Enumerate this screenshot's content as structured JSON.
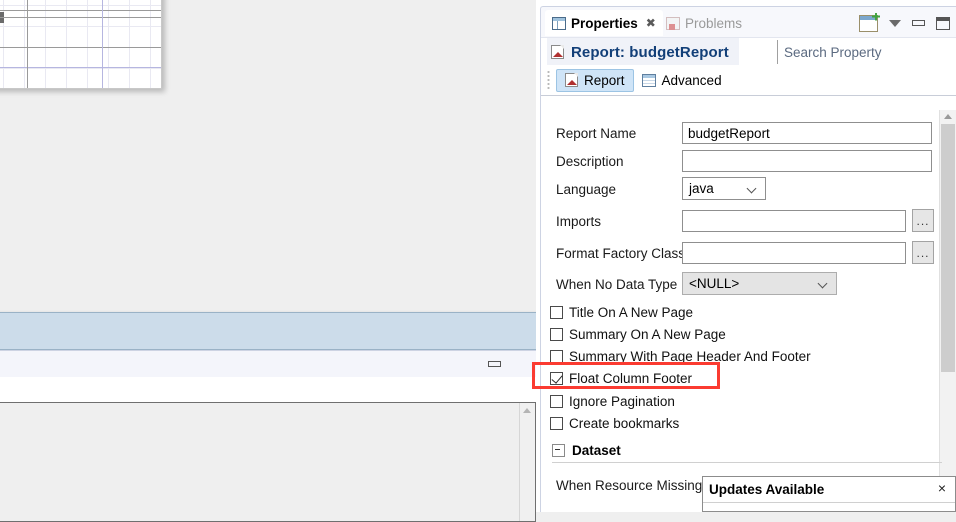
{
  "view": {
    "tabs": [
      {
        "label": "Properties",
        "icon": "table-icon",
        "active": true,
        "closable": true
      },
      {
        "label": "Problems",
        "icon": "problems-icon",
        "active": false,
        "closable": false
      }
    ],
    "toolbar": [
      {
        "name": "new-properties-view-icon",
        "tooltip": "New Properties View"
      },
      {
        "name": "view-menu-icon",
        "tooltip": "View Menu"
      },
      {
        "name": "minimize-icon",
        "tooltip": "Minimize"
      },
      {
        "name": "maximize-icon",
        "tooltip": "Maximize"
      }
    ]
  },
  "header": {
    "icon": "report-icon",
    "title": "Report: budgetReport",
    "search": {
      "placeholder": "Search Property",
      "value": ""
    }
  },
  "subtabs": [
    {
      "label": "Report",
      "icon": "report-icon",
      "selected": true
    },
    {
      "label": "Advanced",
      "icon": "advanced-icon",
      "selected": false
    }
  ],
  "form": {
    "fields": [
      {
        "label": "Report Name",
        "type": "text",
        "value": "budgetReport"
      },
      {
        "label": "Description",
        "type": "text",
        "value": ""
      },
      {
        "label": "Language",
        "type": "combo",
        "value": "java"
      },
      {
        "label": "Imports",
        "type": "text-browse",
        "value": "",
        "browse_label": "..."
      },
      {
        "label": "Format Factory Class",
        "type": "text-browse",
        "value": "",
        "browse_label": "..."
      },
      {
        "label": "When No Data Type",
        "type": "combo-disabled",
        "value": "<NULL>"
      }
    ],
    "checkboxes": [
      {
        "label": "Title On A New Page",
        "checked": false
      },
      {
        "label": "Summary On A New Page",
        "checked": false
      },
      {
        "label": "Summary With Page Header And Footer",
        "checked": false
      },
      {
        "label": "Float Column Footer",
        "checked": true,
        "highlighted": true
      },
      {
        "label": "Ignore Pagination",
        "checked": false
      },
      {
        "label": "Create bookmarks",
        "checked": false
      }
    ],
    "sections": [
      {
        "title": "Dataset",
        "expanded": true
      }
    ],
    "dataset": {
      "first_row_label": "When Resource Missing T"
    }
  },
  "updates_popup": {
    "title": "Updates Available",
    "close_label": "×"
  },
  "annotation": {
    "color": "#fb3b31",
    "target": "Float Column Footer"
  },
  "editor": {
    "band_selected": true,
    "panel_tools": [
      {
        "name": "restore-icon"
      },
      {
        "name": "maximize-icon"
      }
    ]
  },
  "colors": {
    "accent": "#123f78",
    "selection": "#cfe4f7",
    "band_selection": "#ccdcea",
    "highlight": "#fb3b31"
  }
}
